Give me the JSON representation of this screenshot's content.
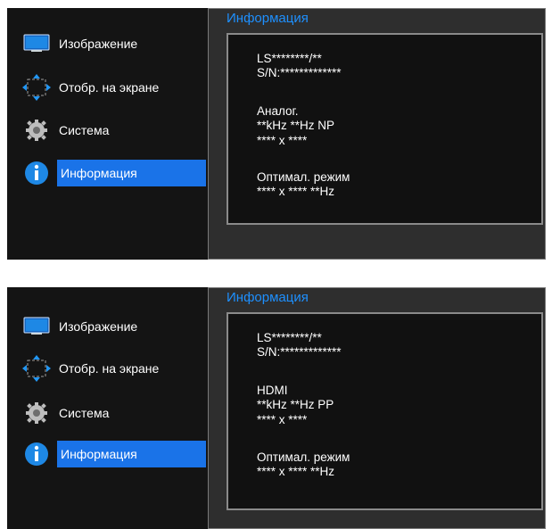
{
  "screens": [
    {
      "menu": {
        "items": [
          {
            "label": "Изображение",
            "icon": "monitor-icon"
          },
          {
            "label": "Отобр. на экране",
            "icon": "move-arrows-icon"
          },
          {
            "label": "Система",
            "icon": "gear-icon"
          },
          {
            "label": "Информация",
            "icon": "info-icon",
            "selected": true
          }
        ]
      },
      "panel": {
        "title": "Информация",
        "model": "LS********/**",
        "serial": "S/N:*************",
        "source": "Аналог.",
        "frequency": "**kHz **Hz NP",
        "resolution": "**** x ****",
        "optimal_label": "Оптимал. режим",
        "optimal_value": "**** x **** **Hz"
      }
    },
    {
      "menu": {
        "items": [
          {
            "label": "Изображение",
            "icon": "monitor-icon"
          },
          {
            "label": "Отобр. на экране",
            "icon": "move-arrows-icon"
          },
          {
            "label": "Система",
            "icon": "gear-icon"
          },
          {
            "label": "Информация",
            "icon": "info-icon",
            "selected": true
          }
        ]
      },
      "panel": {
        "title": "Информация",
        "model": "LS********/**",
        "serial": "S/N:*************",
        "source": "HDMI",
        "frequency": "**kHz **Hz PP",
        "resolution": "**** x ****",
        "optimal_label": "Оптимал. режим",
        "optimal_value": "**** x **** **Hz"
      }
    }
  ],
  "colors": {
    "accent": "#1a73e8",
    "title": "#1e90ff",
    "menu_bg": "#141414",
    "panel_bg": "#2e2e2e"
  }
}
